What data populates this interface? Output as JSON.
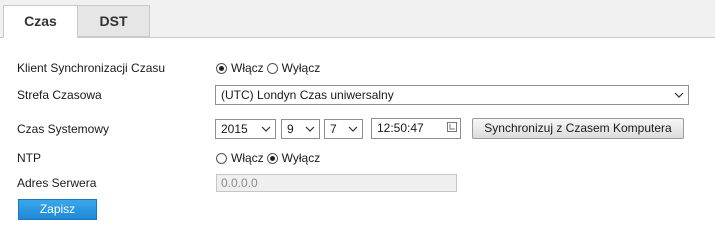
{
  "tabs": [
    {
      "label": "Czas",
      "active": true
    },
    {
      "label": "DST",
      "active": false
    }
  ],
  "sync_client": {
    "label": "Klient Synchronizacji Czasu",
    "on_label": "Włącz",
    "off_label": "Wyłącz",
    "selected": "on"
  },
  "timezone": {
    "label": "Strefa Czasowa",
    "value": "(UTC) Londyn Czas uniwersalny"
  },
  "system_time": {
    "label": "Czas Systemowy",
    "year": "2015",
    "month": "9",
    "day": "7",
    "time": "12:50:47",
    "sync_button": "Synchronizuj z Czasem Komputera"
  },
  "ntp": {
    "label": "NTP",
    "on_label": "Włącz",
    "off_label": "Wyłącz",
    "selected": "off"
  },
  "server": {
    "label": "Adres Serwera",
    "value": "0.0.0.0",
    "disabled": true
  },
  "save_button": "Zapisz",
  "colors": {
    "save_button": "#2a93de",
    "tab_bar": "#f1f1f1"
  }
}
